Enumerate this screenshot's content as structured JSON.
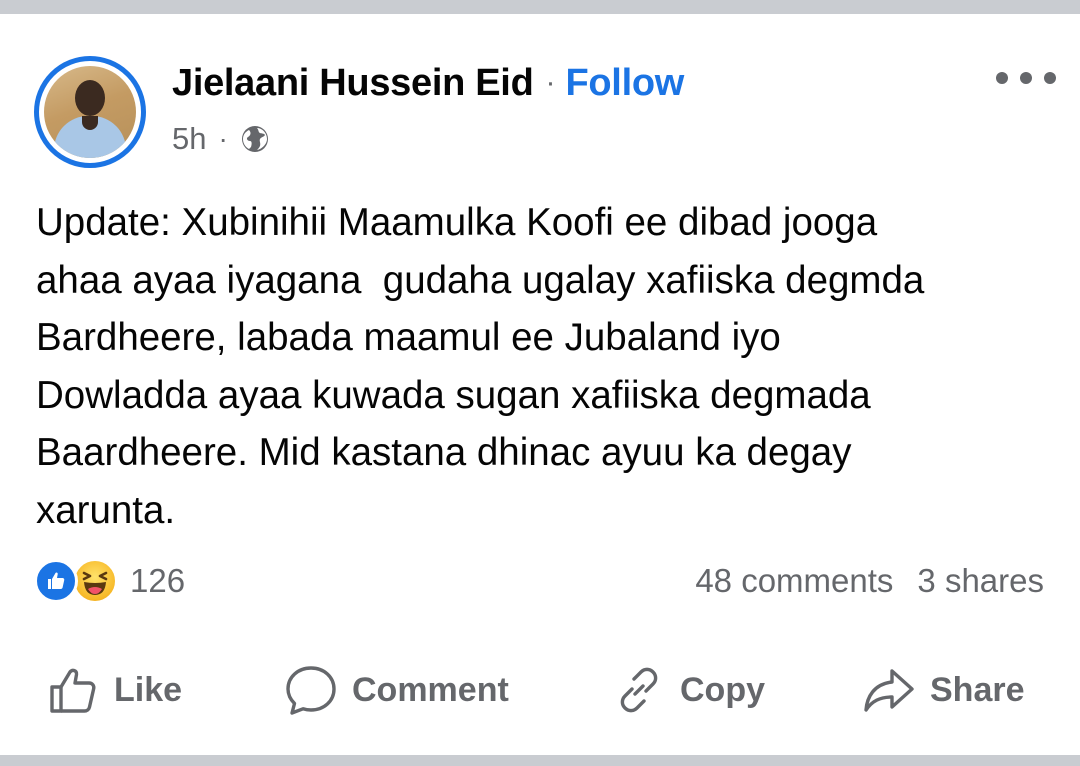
{
  "post": {
    "author": "Jielaani Hussein Eid",
    "separator": "·",
    "follow_label": "Follow",
    "time": "5h",
    "meta_separator": "·",
    "privacy_icon": "globe-icon",
    "text": "Update: Xubinihii Maamulka Koofi ee dibad jooga\nahaa ayaa iyagana  gudaha ugalay xafiiska degmda\nBardheere, labada maamul ee Jubaland iyo\nDowladda ayaa kuwada sugan xafiiska degmada\nBaardheere. Mid kastana dhinac ayuu ka degay\nxarunta."
  },
  "reactions": {
    "icons": [
      "like-reaction-icon",
      "haha-reaction-icon"
    ],
    "count": "126"
  },
  "stats": {
    "comments": "48 comments",
    "shares": "3 shares"
  },
  "actions": {
    "like": "Like",
    "comment": "Comment",
    "copy": "Copy",
    "share": "Share"
  },
  "colors": {
    "accent": "#1b74e4",
    "secondary_text": "#65676b",
    "primary_text": "#050505",
    "divider": "#c9ccd1"
  }
}
